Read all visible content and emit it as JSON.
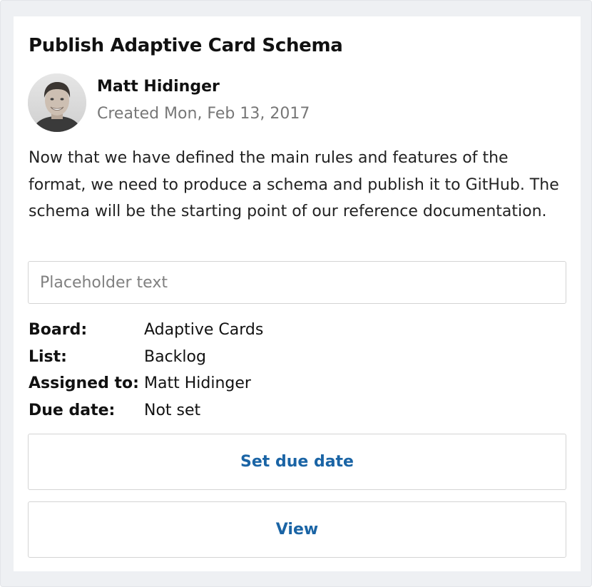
{
  "card": {
    "title": "Publish Adaptive Card Schema",
    "author": {
      "name": "Matt Hidinger",
      "created": "Created Mon, Feb 13, 2017"
    },
    "description": "Now that we have defined the main rules and features of the format, we need to produce a schema and publish it to GitHub. The schema will be the starting point of our reference documentation.",
    "comment_input": {
      "placeholder": "Placeholder text",
      "value": ""
    },
    "facts": [
      {
        "key": "Board:",
        "value": "Adaptive Cards"
      },
      {
        "key": "List:",
        "value": "Backlog"
      },
      {
        "key": "Assigned to:",
        "value": "Matt Hidinger"
      },
      {
        "key": "Due date:",
        "value": "Not set"
      }
    ],
    "actions": {
      "set_due_date": "Set due date",
      "view": "View"
    }
  },
  "colors": {
    "accent": "#1a64a5",
    "outer_background": "#eef0f3",
    "secondary_text": "#777777"
  }
}
